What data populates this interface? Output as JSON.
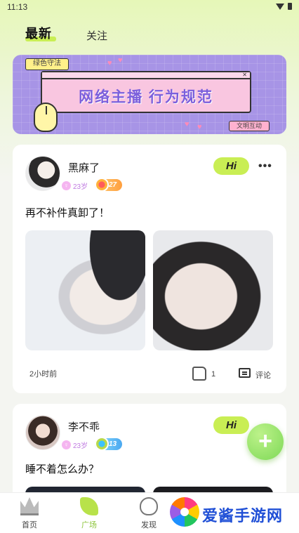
{
  "status_bar": {
    "time": "11:13"
  },
  "tabs": {
    "latest": "最新",
    "follow": "关注"
  },
  "banner": {
    "tag": "绿色守法",
    "title": "网络主播 行为规范",
    "subtag": "文明互动"
  },
  "posts": [
    {
      "username": "黑麻了",
      "age": "23岁",
      "level": "27",
      "hi_label": "Hi",
      "text": "再不补件真卸了！",
      "time": "2小时前",
      "like_count": "1",
      "comment_label": "评论"
    },
    {
      "username": "李不乖",
      "age": "23岁",
      "level": "13",
      "hi_label": "Hi",
      "text": "睡不着怎么办？"
    }
  ],
  "fab": {
    "label": "+"
  },
  "bottom_nav": {
    "items": [
      {
        "label": "首页",
        "icon": "crown-icon"
      },
      {
        "label": "广场",
        "icon": "leaf-icon",
        "active": true
      },
      {
        "label": "发现",
        "icon": "heart-pulse-icon"
      }
    ]
  },
  "watermark": {
    "text": "爱酱手游网"
  },
  "colors": {
    "accent": "#c9ee54",
    "fab": "#7ed957",
    "banner": "#a794e6"
  }
}
